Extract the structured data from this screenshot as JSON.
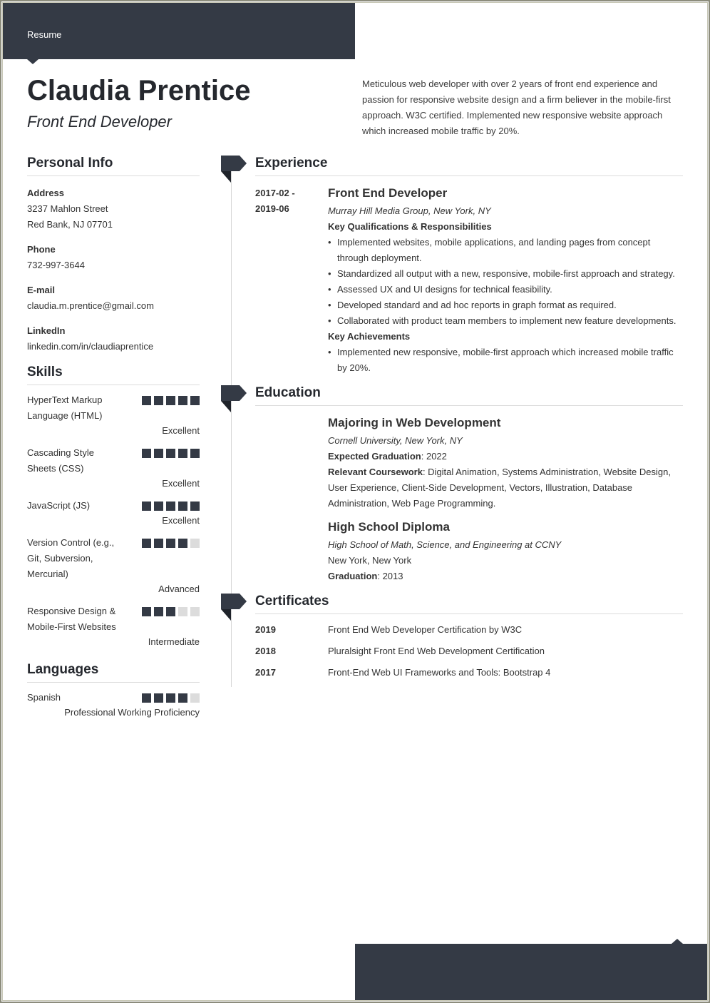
{
  "banner": {
    "label": "Resume"
  },
  "header": {
    "name": "Claudia Prentice",
    "title": "Front End Developer",
    "summary": "Meticulous web developer with over 2 years of front end experience and passion for responsive website design and a firm believer in the mobile-first approach. W3C certified. Implemented new responsive website approach which increased mobile traffic by 20%."
  },
  "colors": {
    "accent": "#343a45",
    "bar_off": "#dcdcdc",
    "rule": "#dcdcdc"
  },
  "personal_info": {
    "heading": "Personal Info",
    "address_label": "Address",
    "address_line1": "3237 Mahlon Street",
    "address_line2": "Red Bank, NJ 07701",
    "phone_label": "Phone",
    "phone": "732-997-3644",
    "email_label": "E-mail",
    "email": "claudia.m.prentice@gmail.com",
    "linkedin_label": "LinkedIn",
    "linkedin": "linkedin.com/in/claudiaprentice"
  },
  "skills": {
    "heading": "Skills",
    "items": [
      {
        "name": "HyperText Markup Language (HTML)",
        "rating": 5,
        "max": 5,
        "level": "Excellent"
      },
      {
        "name": "Cascading Style Sheets (CSS)",
        "rating": 5,
        "max": 5,
        "level": "Excellent"
      },
      {
        "name": "JavaScript (JS)",
        "rating": 5,
        "max": 5,
        "level": "Excellent"
      },
      {
        "name": "Version Control (e.g., Git, Subversion, Mercurial)",
        "rating": 4,
        "max": 5,
        "level": "Advanced"
      },
      {
        "name": "Responsive Design & Mobile-First Websites",
        "rating": 3,
        "max": 5,
        "level": "Intermediate"
      }
    ]
  },
  "languages": {
    "heading": "Languages",
    "items": [
      {
        "name": "Spanish",
        "rating": 4,
        "max": 5,
        "level": "Professional Working Proficiency"
      }
    ]
  },
  "experience": {
    "heading": "Experience",
    "jobs": [
      {
        "date_start": "2017-02 -",
        "date_end": "2019-06",
        "title": "Front End Developer",
        "company": "Murray Hill Media Group, New York, NY",
        "resp_heading": "Key Qualifications & Responsibilities",
        "responsibilities": [
          "Implemented websites, mobile applications, and landing pages from concept through deployment.",
          "Standardized all output with a new, responsive, mobile-first approach and strategy.",
          "Assessed UX and UI designs for technical feasibility.",
          "Developed standard and ad hoc reports in graph format as required.",
          "Collaborated with product team members to implement new feature developments."
        ],
        "ach_heading": "Key Achievements",
        "achievements": [
          "Implemented new responsive, mobile-first approach which increased mobile traffic by 20%."
        ]
      }
    ]
  },
  "education": {
    "heading": "Education",
    "items": [
      {
        "degree": "Majoring in Web Development",
        "school": "Cornell University, New York, NY",
        "grad_label": "Expected Graduation",
        "grad_value": ": 2022",
        "course_label": "Relevant Coursework",
        "course_value": ": Digital Animation, Systems Administration, Website Design, User Experience, Client-Side Development, Vectors, Illustration, Database Administration, Web Page Programming."
      },
      {
        "degree": "High School Diploma",
        "school": "High School of Math, Science, and Engineering at CCNY",
        "location": "New York, New York",
        "grad_label": "Graduation",
        "grad_value": ": 2013"
      }
    ]
  },
  "certificates": {
    "heading": "Certificates",
    "items": [
      {
        "year": "2019",
        "name": "Front End Web Developer Certification by W3C"
      },
      {
        "year": "2018",
        "name": "Pluralsight Front End Web Development Certification"
      },
      {
        "year": "2017",
        "name": "Front-End Web UI Frameworks and Tools: Bootstrap 4"
      }
    ]
  }
}
